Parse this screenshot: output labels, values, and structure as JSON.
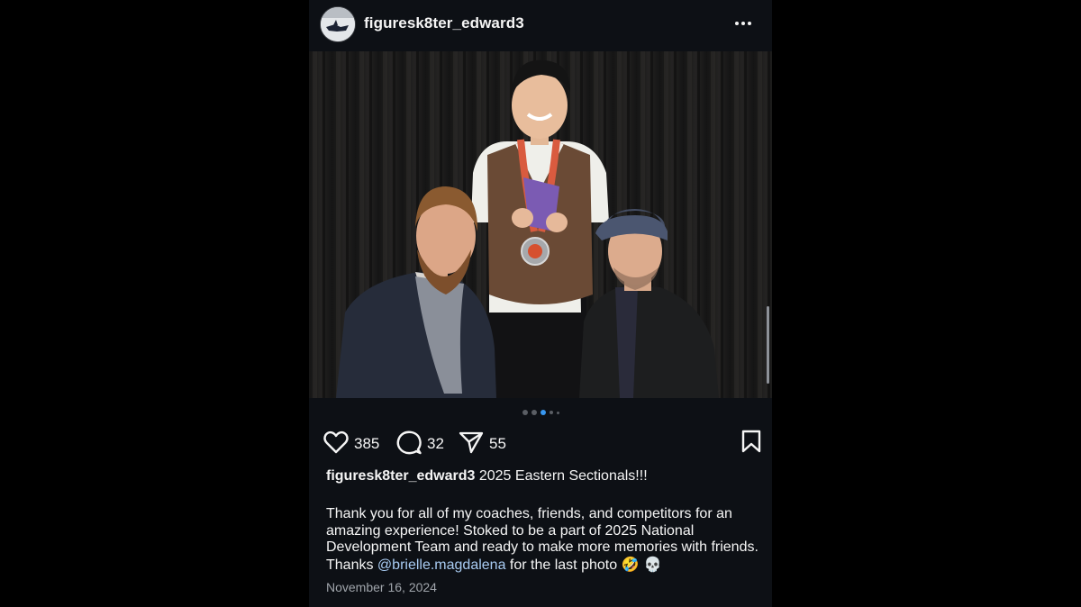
{
  "post": {
    "username": "figuresk8ter_edward3",
    "more_icon": "more-horizontal-icon",
    "carousel": {
      "total": 5,
      "active_index": 2,
      "accent": "#3897f0"
    },
    "actions": {
      "likes": "385",
      "comments": "32",
      "shares": "55"
    },
    "caption": {
      "username": "figuresk8ter_edward3",
      "headline": "2025 Eastern Sectionals!!!",
      "body_before_mention": "Thank you for all of my coaches, friends, and competitors for an amazing experience! Stoked to be a part of 2025 National Development Team and ready to make more memories with friends. Thanks",
      "mention": "@brielle.magdalena",
      "body_after_mention": "for the last photo",
      "emojis": "🤣 💀"
    },
    "date": "November 16, 2024"
  },
  "colors": {
    "background": "#000000",
    "post_bg": "#0d1015",
    "link": "#a9ccf3"
  }
}
